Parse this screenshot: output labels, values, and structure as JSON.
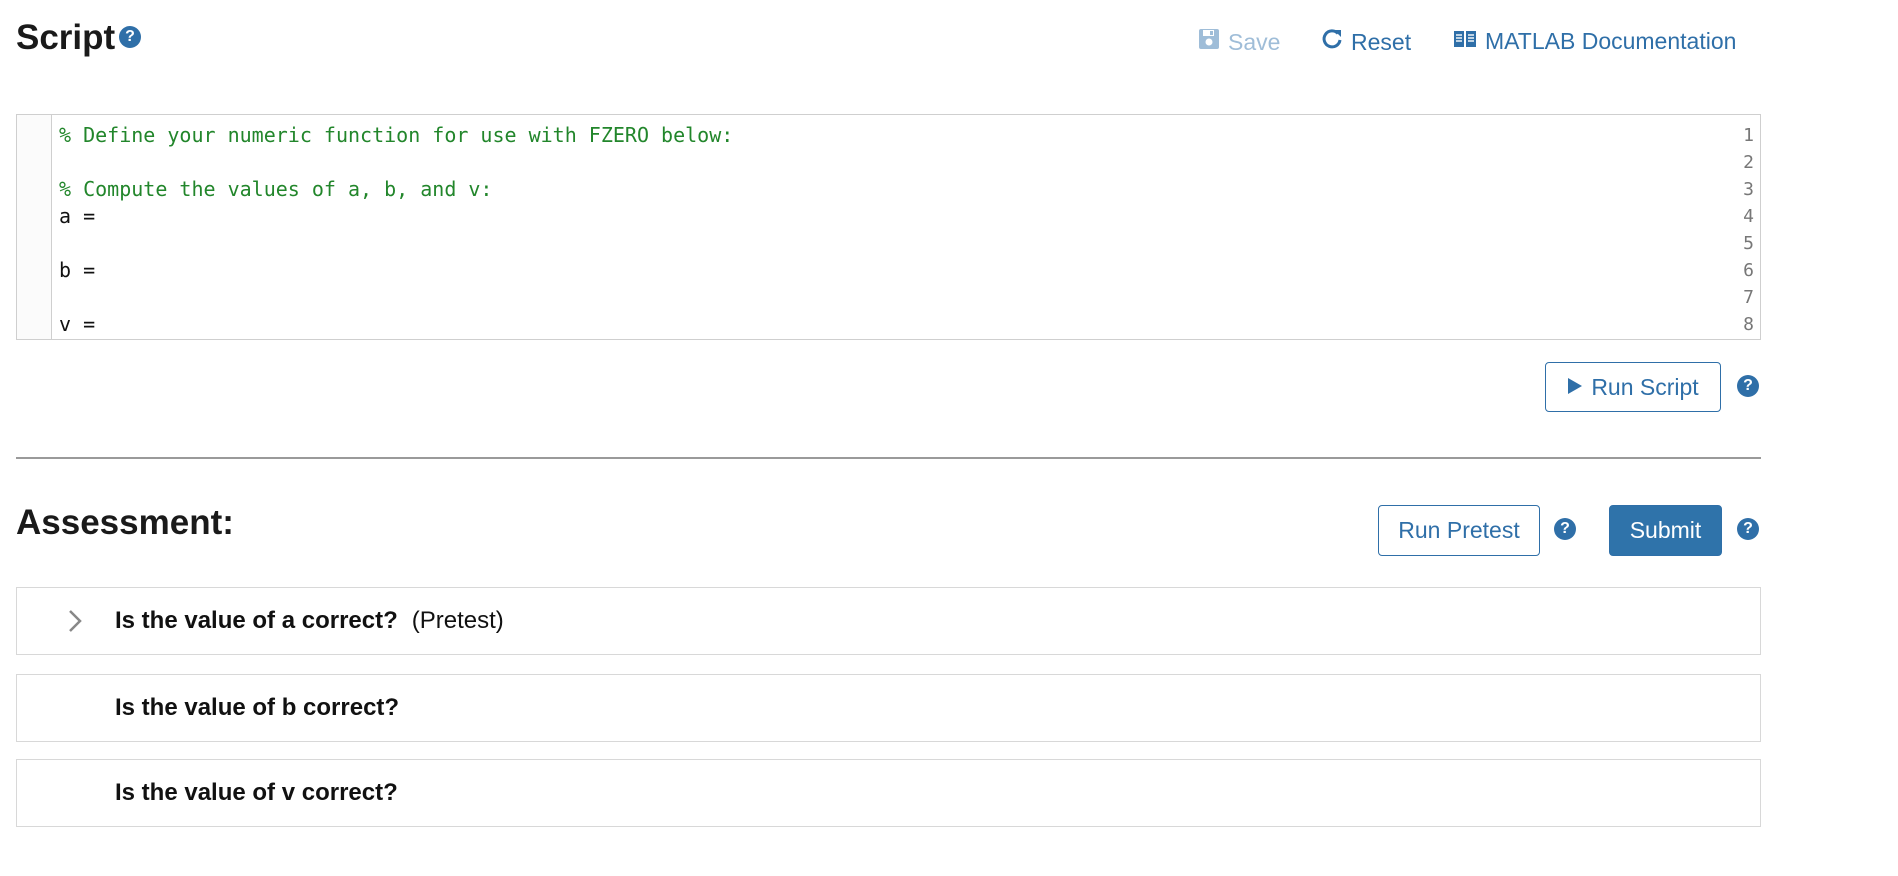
{
  "header": {
    "title": "Script",
    "save_label": "Save",
    "reset_label": "Reset",
    "doc_label": "MATLAB Documentation"
  },
  "editor": {
    "lines": [
      {
        "num": "1",
        "text": "% Define your numeric function for use with FZERO below:",
        "comment": true
      },
      {
        "num": "2",
        "text": "",
        "comment": false
      },
      {
        "num": "3",
        "text": "% Compute the values of a, b, and v:",
        "comment": true
      },
      {
        "num": "4",
        "text": "a =",
        "comment": false
      },
      {
        "num": "5",
        "text": "",
        "comment": false
      },
      {
        "num": "6",
        "text": "b =",
        "comment": false
      },
      {
        "num": "7",
        "text": "",
        "comment": false
      },
      {
        "num": "8",
        "text": "v =",
        "comment": false
      }
    ]
  },
  "run_script_label": "Run Script",
  "help_glyph": "?",
  "assessment": {
    "title": "Assessment:",
    "run_pretest_label": "Run Pretest",
    "submit_label": "Submit",
    "tests": [
      {
        "label": "Is the value of a correct?",
        "tag": "(Pretest)"
      },
      {
        "label": "Is the value of b correct?",
        "tag": ""
      },
      {
        "label": "Is the value of v correct?",
        "tag": ""
      }
    ]
  },
  "colors": {
    "accent": "#2f6fa8",
    "comment": "#22862b",
    "disabled": "#9fbdd8"
  }
}
